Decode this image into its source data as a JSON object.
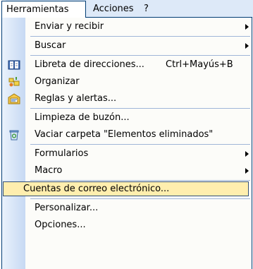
{
  "menubar": {
    "items": [
      "Herramientas",
      "Acciones",
      "?"
    ]
  },
  "menu": {
    "items": [
      {
        "label": "Enviar y recibir",
        "submenu": true
      },
      {
        "label": "Buscar",
        "submenu": true
      },
      {
        "label": "Libreta de direcciones...",
        "shortcut": "Ctrl+Mayús+B",
        "icon": "address-book-icon"
      },
      {
        "label": "Organizar",
        "icon": "organize-icon"
      },
      {
        "label": "Reglas y alertas...",
        "icon": "rules-alerts-icon"
      },
      {
        "label": "Limpieza de buzón..."
      },
      {
        "label": "Vaciar carpeta \"Elementos eliminados\"",
        "icon": "trash-icon"
      },
      {
        "label": "Formularios",
        "submenu": true
      },
      {
        "label": "Macro",
        "submenu": true
      },
      {
        "label": "Cuentas de correo electrónico...",
        "highlighted": true
      },
      {
        "label": "Personalizar..."
      },
      {
        "label": "Opciones..."
      }
    ]
  },
  "colors": {
    "menubar_bg": "#dde9f8",
    "border": "#003c74",
    "highlight_bg": "#ffeeae",
    "highlight_border": "#314f78",
    "gutter_light": "#eaf2fc",
    "gutter_dark": "#c6d9f3"
  }
}
